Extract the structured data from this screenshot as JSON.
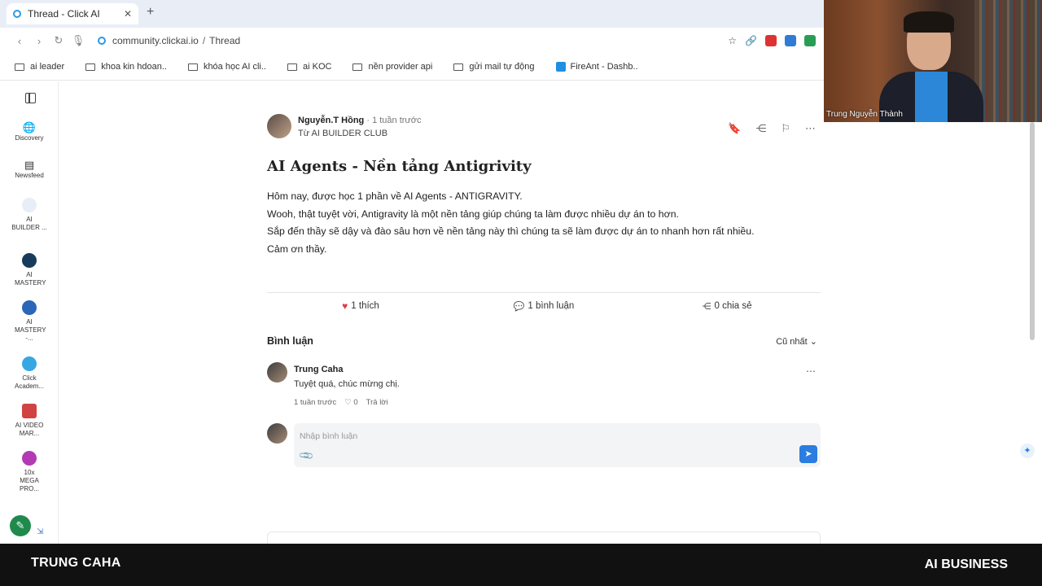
{
  "browser": {
    "tab_title": "Thread - Click AI",
    "new_tab": "+",
    "url_domain": "community.clickai.io",
    "url_sep": "/",
    "url_path": "Thread"
  },
  "bookmarks": [
    "ai leader",
    "khoa kin hdoan..",
    "khóa học AI cli..",
    "ai KOC",
    "nền provider api",
    "gửi mail tự động",
    "FireAnt - Dashb.."
  ],
  "sidebar": {
    "items": [
      {
        "label": "Discovery",
        "icon": "globe-icon"
      },
      {
        "label": "Newsfeed",
        "icon": "newsfeed-icon"
      },
      {
        "label": "AI BUILDER ...",
        "icon": "group-logo-icon",
        "color": "#e7eef7"
      },
      {
        "label": "AI MASTERY",
        "icon": "group-logo-icon",
        "color": "#173b5a"
      },
      {
        "label": "AI MASTERY -...",
        "icon": "group-logo-icon",
        "color": "#2b66b8"
      },
      {
        "label": "Click Academ...",
        "icon": "click-logo-icon",
        "color": "#36a7e3"
      },
      {
        "label": "AI VIDEO MAR...",
        "icon": "video-logo-icon",
        "color": "#d14343"
      },
      {
        "label": "10x MEGA PRO...",
        "icon": "mega-logo-icon",
        "color": "#b33ab5"
      }
    ]
  },
  "post": {
    "author": "Nguyễn.T Hồng",
    "time": "· 1 tuần trước",
    "group": "Từ AI BUILDER CLUB",
    "title": "AI Agents - Nền tảng Antigrivity",
    "body": [
      "Hôm nay, được học 1 phần về AI Agents -  ANTIGRAVITY.",
      "Wooh, thật tuyệt vời, Antigravity là một nền tảng giúp chúng ta làm được nhiều dự án to hơn.",
      "Sắp đến thầy sẽ dậy và đào sâu hơn về nền tảng này thì chúng ta sẽ làm được dự án to nhanh hơn rất nhiều.",
      "Cảm ơn thầy."
    ],
    "likes": "1 thích",
    "comments": "1 bình luận",
    "shares": "0 chia sẻ"
  },
  "comments_section": {
    "heading": "Bình luận",
    "sort": "Cũ nhất",
    "items": [
      {
        "name": "Trung Caha",
        "text": "Tuyệt quá, chúc mừng chị.",
        "time": "1 tuần trước",
        "likes": "0",
        "reply": "Trả lời"
      }
    ],
    "input_placeholder": "Nhập bình luận"
  },
  "webcam": {
    "name": "Trung Nguyễn Thành"
  },
  "footer": {
    "left": "TRUNG CAHA",
    "right": "AI BUSINESS"
  },
  "colors": {
    "accent": "#2b7de0",
    "heart": "#e23b4a",
    "footer_bg": "#111111"
  }
}
